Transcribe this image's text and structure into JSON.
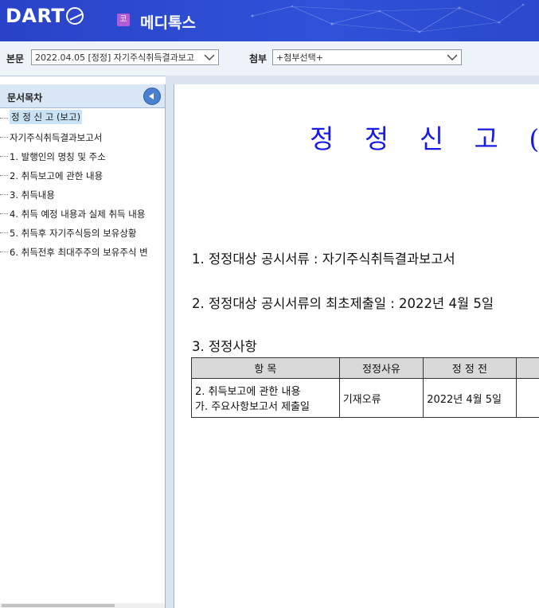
{
  "header": {
    "logo_text": "DART",
    "corp_badge": "코",
    "corp_name": "메디톡스"
  },
  "toolbar": {
    "main_label": "본문",
    "main_select_value": "2022.04.05 [정정] 자기주식취득결과보고",
    "attach_label": "첨부",
    "attach_select_value": "+첨부선택+"
  },
  "sidebar": {
    "title": "문서목차",
    "items": [
      {
        "label": "정 정 신 고 (보고)"
      },
      {
        "label": "자기주식취득결과보고서"
      },
      {
        "label": "1. 발행인의 명칭 및 주소"
      },
      {
        "label": "2. 취득보고에 관한 내용"
      },
      {
        "label": "3. 취득내용"
      },
      {
        "label": "4. 취득 예정 내용과 실제 취득 내용"
      },
      {
        "label": "5. 취득후 자기주식등의 보유상황"
      },
      {
        "label": "6. 취득전후 최대주주의 보유주식 변"
      }
    ]
  },
  "document": {
    "title": "정 정 신 고 (보고",
    "line1": "1. 정정대상 공시서류 : 자기주식취득결과보고서",
    "line2": "2. 정정대상 공시서류의 최초제출일 : 2022년 4월 5일",
    "line3": "3. 정정사항",
    "table": {
      "headers": [
        "항 목",
        "정정사유",
        "정 정 전"
      ],
      "row": {
        "item_line1": "2. 취득보고에 관한 내용",
        "item_line2": "가. 주요사항보고서 제출일",
        "reason": "기재오류",
        "before": "2022년 4월 5일"
      }
    }
  },
  "colors": {
    "header_blue": "#2f52d8",
    "title_blue": "#1a1ae6",
    "selected_bg": "#c9e3f5"
  }
}
